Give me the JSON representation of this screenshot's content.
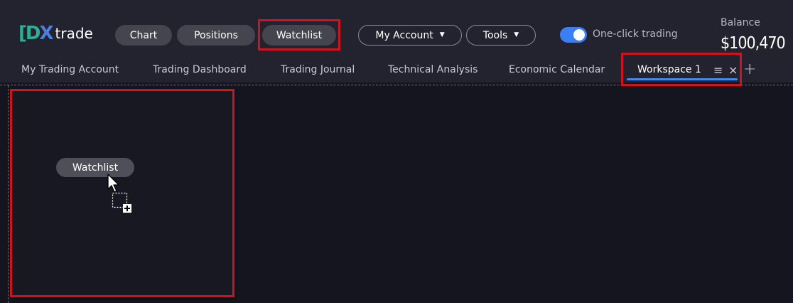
{
  "logo": {
    "mark_left": "[",
    "mark_d": "D",
    "mark_x": "X",
    "text": "trade"
  },
  "toolbar": {
    "chart": "Chart",
    "positions": "Positions",
    "watchlist": "Watchlist",
    "my_account": "My Account",
    "tools": "Tools",
    "caret": "▼",
    "one_click_label": "One-click trading",
    "one_click_enabled": true
  },
  "balance": {
    "label": "Balance",
    "value": "$100,470"
  },
  "tabs": {
    "items": [
      {
        "label": "My Trading Account"
      },
      {
        "label": "Trading Dashboard"
      },
      {
        "label": "Trading Journal"
      },
      {
        "label": "Technical Analysis"
      },
      {
        "label": "Economic Calendar"
      },
      {
        "label": "Workspace 1"
      }
    ],
    "active_index": 5,
    "menu_glyph": "≡",
    "close_glyph": "×",
    "add_glyph": "+"
  },
  "workspace": {
    "drag_chip": "Watchlist"
  },
  "colors": {
    "accent": "#3b7ff4",
    "highlight": "#d4121f",
    "background": "#151520",
    "toolbar": "#23232f"
  },
  "icons": {
    "cursor": "arrow-cursor-icon",
    "drop": "drop-add-icon",
    "toggle": "toggle-switch-icon"
  }
}
